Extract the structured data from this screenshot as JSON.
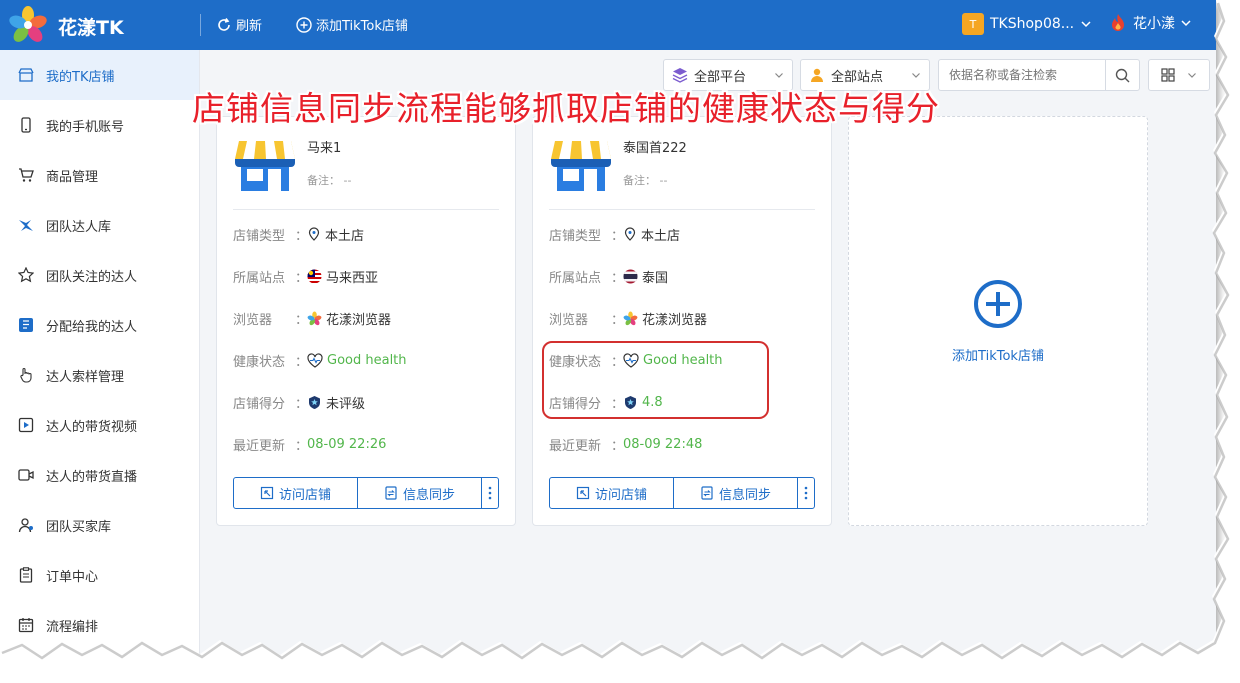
{
  "app": {
    "title": "花漾TK"
  },
  "toolbar": {
    "refresh_label": "刷新",
    "add_shop_label": "添加TikTok店铺"
  },
  "account": {
    "shop_badge": "T",
    "shop_name": "TKShop08...",
    "user_name": "花小漾"
  },
  "sidebar": {
    "items": [
      {
        "label": "我的TK店铺",
        "icon": "store-icon",
        "active": true
      },
      {
        "label": "我的手机账号",
        "icon": "phone-icon"
      },
      {
        "label": "商品管理",
        "icon": "cart-icon"
      },
      {
        "label": "团队达人库",
        "icon": "creator-icon"
      },
      {
        "label": "团队关注的达人",
        "icon": "star-icon"
      },
      {
        "label": "分配给我的达人",
        "icon": "assign-icon"
      },
      {
        "label": "达人索样管理",
        "icon": "hand-icon"
      },
      {
        "label": "达人的带货视频",
        "icon": "video-icon"
      },
      {
        "label": "达人的带货直播",
        "icon": "live-icon"
      },
      {
        "label": "团队买家库",
        "icon": "buyer-icon"
      },
      {
        "label": "订单中心",
        "icon": "order-icon"
      },
      {
        "label": "流程编排",
        "icon": "calendar-icon"
      }
    ]
  },
  "filters": {
    "platform": "全部平台",
    "site": "全部站点",
    "search_placeholder": "依据名称或备注检索"
  },
  "banner": "店铺信息同步流程能够抓取店铺的健康状态与得分",
  "labels": {
    "type": "店铺类型",
    "site": "所属站点",
    "browser": "浏览器",
    "health": "健康状态",
    "score": "店铺得分",
    "updated": "最近更新",
    "colon": "：",
    "note": "备注：",
    "visit": "访问店铺",
    "sync": "信息同步"
  },
  "shops": [
    {
      "name": "马来1",
      "note": "--",
      "type": "本土店",
      "site": "马来西亚",
      "browser": "花漾浏览器",
      "health": "Good health",
      "score": "未评级",
      "updated": "08-09 22:26"
    },
    {
      "name": "泰国首222",
      "note": "--",
      "type": "本土店",
      "site": "泰国",
      "browser": "花漾浏览器",
      "health": "Good health",
      "score": "4.8",
      "updated": "08-09 22:48"
    }
  ],
  "add_card": {
    "label": "添加TikTok店铺"
  },
  "colors": {
    "brand": "#1e6dc8",
    "good": "#52b64b",
    "annotation": "#e8202a"
  }
}
